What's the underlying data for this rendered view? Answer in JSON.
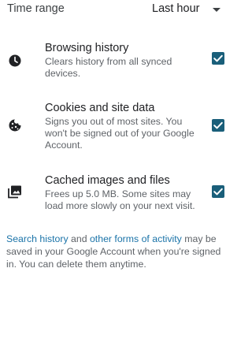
{
  "time_range": {
    "label": "Time range",
    "value": "Last hour"
  },
  "options": [
    {
      "title": "Browsing history",
      "description": "Clears history from all synced devices.",
      "checked": true,
      "icon": "clock-icon"
    },
    {
      "title": "Cookies and site data",
      "description": "Signs you out of most sites. You won't be signed out of your Google Account.",
      "checked": true,
      "icon": "cookie-icon"
    },
    {
      "title": "Cached images and files",
      "description": "Frees up 5.0 MB. Some sites may load more slowly on your next visit.",
      "checked": true,
      "icon": "images-icon"
    }
  ],
  "footer": {
    "link_search_history": "Search history",
    "text_and": " and ",
    "link_other_activity": "other forms of activity",
    "text_rest": " may be saved in your Google Account when you're signed in. You can delete them anytime."
  },
  "colors": {
    "accent": "#1a5f7a",
    "link": "#1a73a8"
  }
}
